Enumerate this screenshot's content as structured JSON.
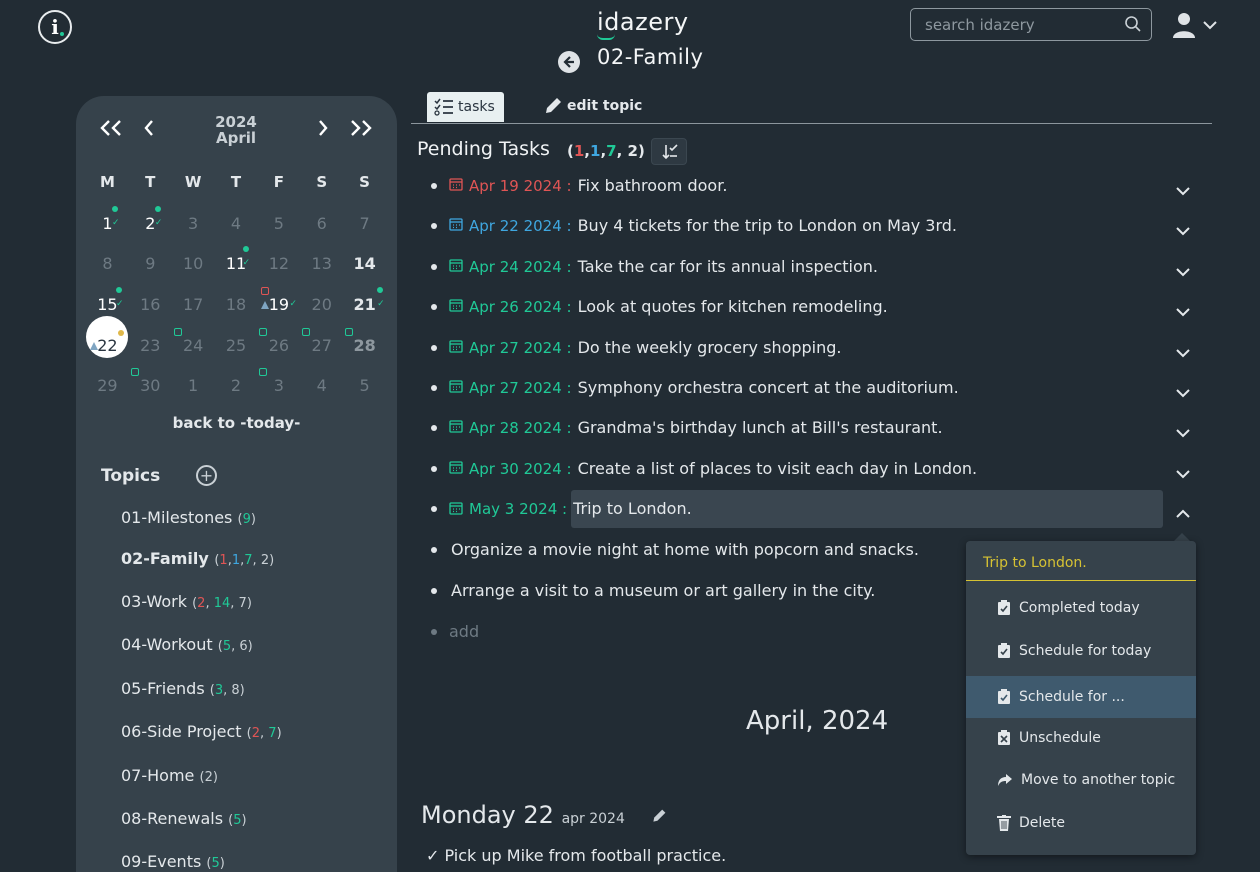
{
  "app": {
    "title": "idazery",
    "topic": "02-Family"
  },
  "search": {
    "placeholder": "search idazery"
  },
  "calendar": {
    "year": "2024",
    "month": "April",
    "weekdays": [
      "M",
      "T",
      "W",
      "T",
      "F",
      "S",
      "S"
    ],
    "weeks": [
      [
        "1",
        "2",
        "3",
        "4",
        "5",
        "6",
        "7"
      ],
      [
        "8",
        "9",
        "10",
        "11",
        "12",
        "13",
        "14"
      ],
      [
        "15",
        "16",
        "17",
        "18",
        "19",
        "20",
        "21"
      ],
      [
        "22",
        "23",
        "24",
        "25",
        "26",
        "27",
        "28"
      ],
      [
        "29",
        "30",
        "1",
        "2",
        "3",
        "4",
        "5"
      ]
    ],
    "back_today": "back to -today-"
  },
  "topics": {
    "title": "Topics",
    "items": [
      {
        "name": "01-Milestones",
        "counts": [
          {
            "v": "9",
            "c": "green"
          }
        ]
      },
      {
        "name": "02-Family",
        "counts": [
          {
            "v": "1",
            "c": "red"
          },
          {
            "v": "1",
            "c": "blue"
          },
          {
            "v": "7",
            "c": "green"
          },
          {
            "v": "2",
            "c": "white"
          }
        ]
      },
      {
        "name": "03-Work",
        "counts": [
          {
            "v": "2",
            "c": "red"
          },
          {
            "v": "14",
            "c": "green"
          },
          {
            "v": "7",
            "c": "white"
          }
        ]
      },
      {
        "name": "04-Workout",
        "counts": [
          {
            "v": "5",
            "c": "green"
          },
          {
            "v": "6",
            "c": "white"
          }
        ]
      },
      {
        "name": "05-Friends",
        "counts": [
          {
            "v": "3",
            "c": "green"
          },
          {
            "v": "8",
            "c": "white"
          }
        ]
      },
      {
        "name": "06-Side Project",
        "counts": [
          {
            "v": "2",
            "c": "red"
          },
          {
            "v": "7",
            "c": "green"
          }
        ]
      },
      {
        "name": "07-Home",
        "counts": [
          {
            "v": "2",
            "c": "white"
          }
        ]
      },
      {
        "name": "08-Renewals",
        "counts": [
          {
            "v": "5",
            "c": "green"
          }
        ]
      },
      {
        "name": "09-Events",
        "counts": [
          {
            "v": "5",
            "c": "green"
          }
        ]
      }
    ]
  },
  "tabs": {
    "tasks": "tasks",
    "edit": "edit topic"
  },
  "pending": {
    "title": "Pending Tasks",
    "counts": [
      {
        "v": "1",
        "c": "red"
      },
      {
        "v": "1",
        "c": "blue"
      },
      {
        "v": "7",
        "c": "green"
      },
      {
        "v": "2",
        "c": "white"
      }
    ],
    "tasks": [
      {
        "date": "Apr 19 2024 :",
        "text": "Fix bathroom door.",
        "color": "#e05555"
      },
      {
        "date": "Apr 22 2024 :",
        "text": "Buy 4 tickets for the trip to London on May 3rd.",
        "color": "#3fa7e0"
      },
      {
        "date": "Apr 24 2024 :",
        "text": "Take the car for its annual inspection.",
        "color": "#20c997"
      },
      {
        "date": "Apr 26 2024 :",
        "text": "Look at quotes for kitchen remodeling.",
        "color": "#20c997"
      },
      {
        "date": "Apr 27 2024 :",
        "text": "Do the weekly grocery shopping.",
        "color": "#20c997"
      },
      {
        "date": "Apr 27 2024 :",
        "text": "Symphony orchestra concert at the auditorium.",
        "color": "#20c997"
      },
      {
        "date": "Apr 28 2024 :",
        "text": "Grandma's birthday lunch at Bill's restaurant.",
        "color": "#20c997"
      },
      {
        "date": "Apr 30 2024 :",
        "text": "Create a list of places to visit each day in London.",
        "color": "#20c997"
      },
      {
        "date": "May 3 2024 :",
        "text": "Trip to London.",
        "color": "#20c997"
      }
    ],
    "unscheduled": [
      "Organize a movie night at home with popcorn and snacks.",
      "Arrange a visit to a museum or art gallery in the city."
    ],
    "add_label": "add"
  },
  "month_title": "April, 2024",
  "day": {
    "title": "Monday 22",
    "sub": "apr 2024",
    "task": "Pick up Mike from football practice."
  },
  "context_menu": {
    "title": "Trip to London.",
    "items": [
      "Completed today",
      "Schedule for today",
      "Schedule for ...",
      "Unschedule",
      "Move to another topic",
      "Delete"
    ]
  },
  "colors": {
    "accent": "#20c997",
    "overdue": "#e05555",
    "today": "#3fa7e0",
    "menu_title": "#d6c233"
  }
}
